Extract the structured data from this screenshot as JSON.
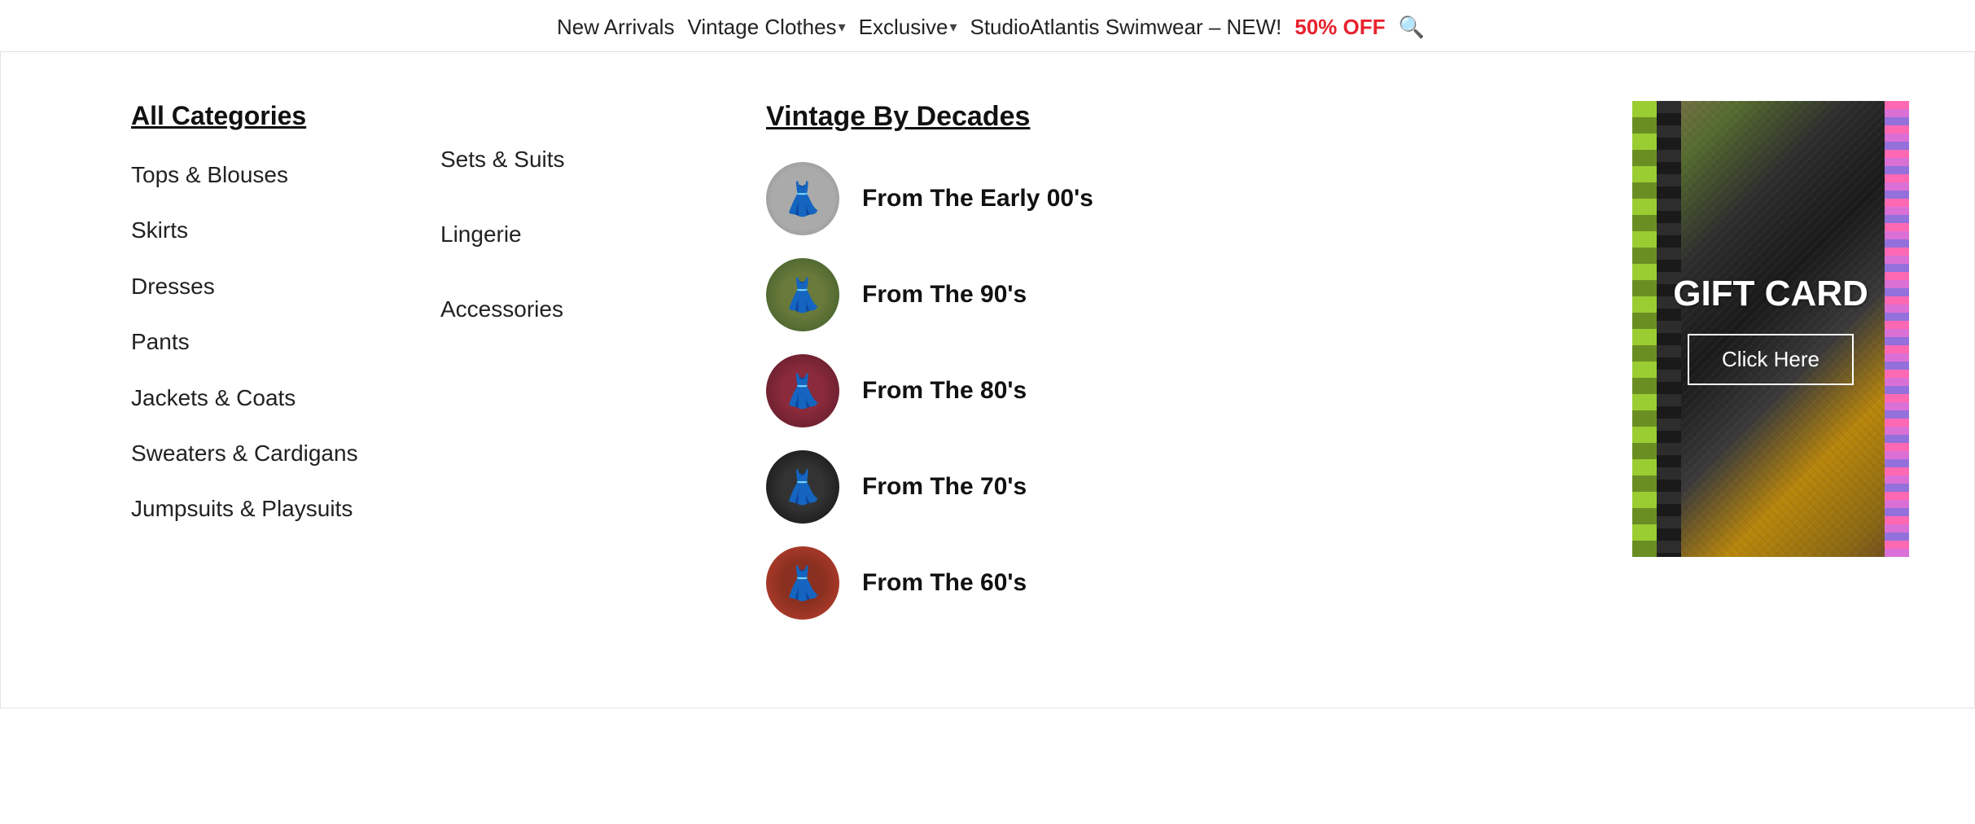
{
  "topnav": {
    "items": [
      {
        "id": "new-arrivals",
        "label": "New Arrivals"
      },
      {
        "id": "vintage-clothes",
        "label": "Vintage Clothes",
        "hasChevron": true
      },
      {
        "id": "exclusive",
        "label": "Exclusive",
        "hasChevron": true
      },
      {
        "id": "studio-atlantis",
        "label": "StudioAtlantis Swimwear – NEW!"
      },
      {
        "id": "sale",
        "label": "50% OFF",
        "isSale": true
      }
    ],
    "search_icon": "🔍"
  },
  "megamenu": {
    "all_categories_title": "All Categories",
    "categories": [
      {
        "id": "tops-blouses",
        "label": "Tops & Blouses"
      },
      {
        "id": "skirts",
        "label": "Skirts"
      },
      {
        "id": "dresses",
        "label": "Dresses"
      },
      {
        "id": "pants",
        "label": "Pants"
      },
      {
        "id": "jackets-coats",
        "label": "Jackets & Coats"
      },
      {
        "id": "sweaters-cardigans",
        "label": "Sweaters & Cardigans"
      },
      {
        "id": "jumpsuits-playsuits",
        "label": "Jumpsuits & Playsuits"
      }
    ],
    "secondary": [
      {
        "id": "sets-suits",
        "label": "Sets & Suits"
      },
      {
        "id": "lingerie",
        "label": "Lingerie"
      },
      {
        "id": "accessories",
        "label": "Accessories"
      }
    ],
    "decades_title": "Vintage By Decades",
    "decades": [
      {
        "id": "early-00s",
        "label": "From The Early 00's",
        "thumb": "thumb-00s"
      },
      {
        "id": "90s",
        "label": "From The 90's",
        "thumb": "thumb-90s"
      },
      {
        "id": "80s",
        "label": "From The 80's",
        "thumb": "thumb-80s"
      },
      {
        "id": "70s",
        "label": "From The 70's",
        "thumb": "thumb-70s"
      },
      {
        "id": "60s",
        "label": "From The 60's",
        "thumb": "thumb-60s"
      }
    ],
    "gift_card": {
      "title": "GIFT CARD",
      "button_label": "Click Here"
    }
  }
}
